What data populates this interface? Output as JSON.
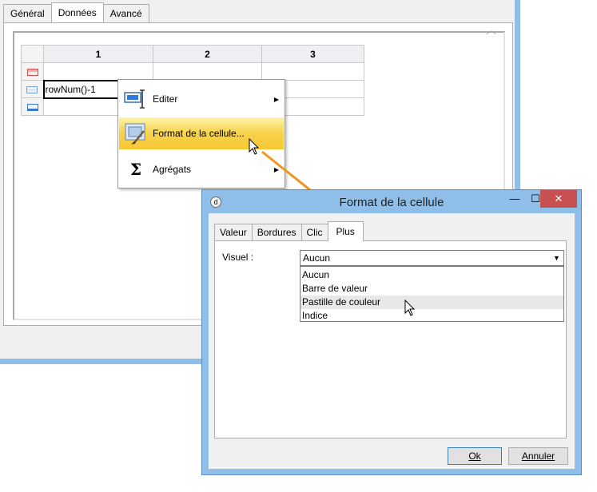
{
  "background_window": {
    "tabs": [
      "Général",
      "Données",
      "Avancé"
    ],
    "active_tab": "Données",
    "grid": {
      "columns": [
        "1",
        "2",
        "3"
      ],
      "edited_cell_value": "rowNum()-1"
    }
  },
  "context_menu": {
    "items": [
      {
        "label": "Editer",
        "icon": "edit-icon",
        "submenu": true
      },
      {
        "label": "Format de la cellule...",
        "icon": "cell-format-icon",
        "submenu": false,
        "highlighted": true
      },
      {
        "label": "Agrégats",
        "icon": "sigma-icon",
        "submenu": true
      }
    ]
  },
  "dialog": {
    "title": "Format de la cellule",
    "title_icon_glyph": "d",
    "controls": {
      "minimize": "—",
      "maximize": "☐",
      "close": "✕"
    },
    "tabs": [
      "Valeur",
      "Bordures",
      "Clic",
      "Plus"
    ],
    "active_tab": "Plus",
    "visuel_label": "Visuel :",
    "visuel_value": "Aucun",
    "visuel_options": [
      "Aucun",
      "Barre de valeur",
      "Pastille de couleur",
      "Indice"
    ],
    "hovered_option": "Pastille de couleur",
    "ok_label": "Ok",
    "cancel_label": "Annuler"
  },
  "colors": {
    "window_frame": "#8fbfe8",
    "menu_highlight": "#f7d24a",
    "annotation_arrow": "#f0961e",
    "close_button": "#c75050"
  }
}
